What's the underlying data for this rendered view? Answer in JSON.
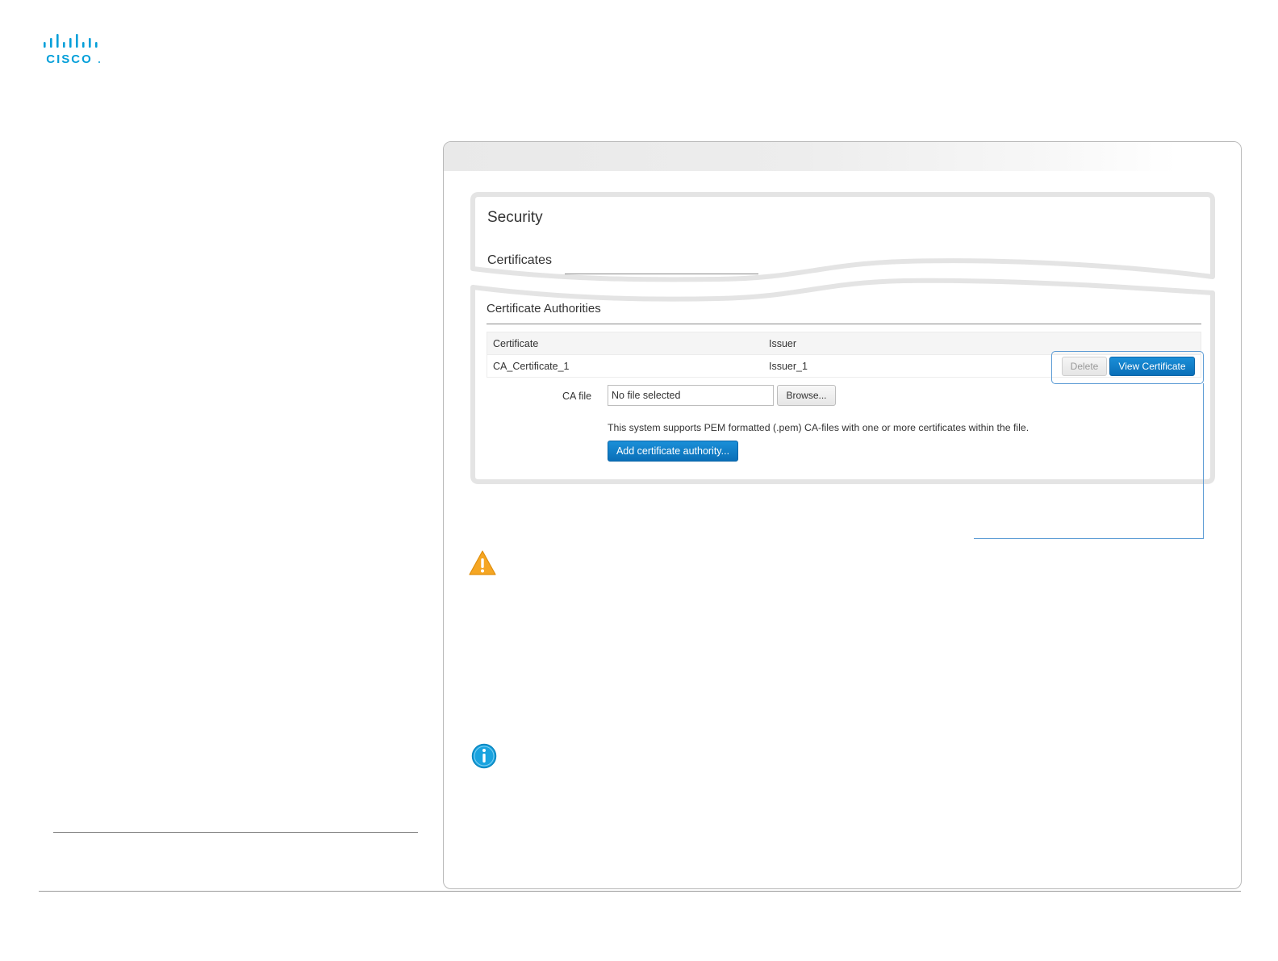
{
  "brand": {
    "logo_text": "CISCO",
    "logo_color": "#049fd9"
  },
  "security_card": {
    "title": "Security",
    "subtitle": "Certificates"
  },
  "ca_card": {
    "title": "Certificate Authorities",
    "table": {
      "headers": [
        "Certificate",
        "Issuer"
      ],
      "rows": [
        {
          "certificate": "CA_Certificate_1",
          "issuer": "Issuer_1"
        }
      ]
    },
    "row_actions": {
      "delete_label": "Delete",
      "view_label": "View Certificate"
    },
    "ca_file": {
      "label": "CA file",
      "value": "No file selected",
      "browse_label": "Browse..."
    },
    "help_text": "This system supports PEM formatted (.pem) CA-files with one or more certificates within the file.",
    "add_button_label": "Add certificate authority..."
  },
  "icons": {
    "warning": "warning-icon",
    "info": "info-icon"
  },
  "colors": {
    "accent": "#0a7cc8",
    "callout": "#5b9bd5",
    "warning": "#f5a623",
    "info": "#1aa3df"
  }
}
